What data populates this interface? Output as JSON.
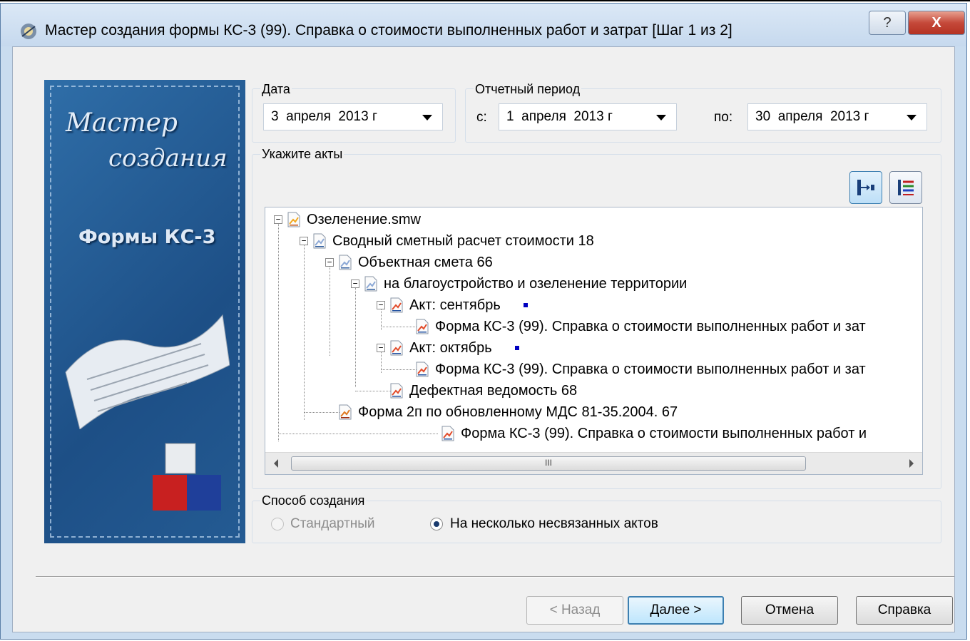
{
  "window": {
    "title": "Мастер создания формы КС-3 (99). Справка о стоимости выполненных работ и затрат [Шаг 1 из 2]",
    "help_button": "?",
    "close_button": "X"
  },
  "banner": {
    "line1": "Мастер",
    "line2": "создания",
    "line3": "Формы КС-3"
  },
  "date_group": {
    "label": "Дата",
    "value": "3  апреля  2013 г"
  },
  "period_group": {
    "label": "Отчетный период",
    "from_label": "с:",
    "from_value": "1  апреля  2013 г",
    "to_label": "по:",
    "to_value": "30  апреля  2013 г"
  },
  "acts_group": {
    "label": "Укажите акты",
    "toolbar": [
      "expand-tree-icon",
      "list-tree-icon"
    ]
  },
  "tree": [
    {
      "label": "Озеленение.smw",
      "icon": "project-file-icon",
      "expander": "−"
    },
    {
      "label": "Сводный сметный расчет стоимости 18",
      "icon": "estimate-doc-icon",
      "expander": "−"
    },
    {
      "label": "Объектная смета 66",
      "icon": "estimate-doc-icon",
      "expander": "−"
    },
    {
      "label": "на благоустройство и озеленение территории",
      "icon": "estimate-doc-icon",
      "expander": "−"
    },
    {
      "label": "Акт: сентябрь",
      "icon": "act-doc-icon",
      "expander": "−"
    },
    {
      "label": "Форма КС-3 (99). Справка о стоимости выполненных работ и зат",
      "icon": "form-doc-icon",
      "expander": ""
    },
    {
      "label": "Акт: октябрь",
      "icon": "act-doc-icon",
      "expander": "−"
    },
    {
      "label": "Форма КС-3 (99). Справка о стоимости выполненных работ и зат",
      "icon": "form-doc-icon",
      "expander": ""
    },
    {
      "label": "Дефектная ведомость 68",
      "icon": "act-doc-icon",
      "expander": ""
    },
    {
      "label": "Форма 2п по обновленному МДС 81-35.2004. 67",
      "icon": "form2p-doc-icon",
      "expander": ""
    },
    {
      "label": "Форма КС-3 (99). Справка о стоимости выполненных работ и",
      "icon": "form-doc-icon",
      "expander": ""
    }
  ],
  "scrollbar": {
    "thumb_grip": "III"
  },
  "method_group": {
    "label": "Способ создания",
    "option_standard": "Стандартный",
    "option_multiple": "На несколько несвязанных актов",
    "selected": "option_multiple"
  },
  "buttons": {
    "back": "< Назад",
    "next": "Далее >",
    "cancel": "Отмена",
    "help": "Справка"
  },
  "colors": {
    "accent": "#3c7fb1",
    "banner": "#2f6ea8",
    "marker": "#0000c0"
  }
}
